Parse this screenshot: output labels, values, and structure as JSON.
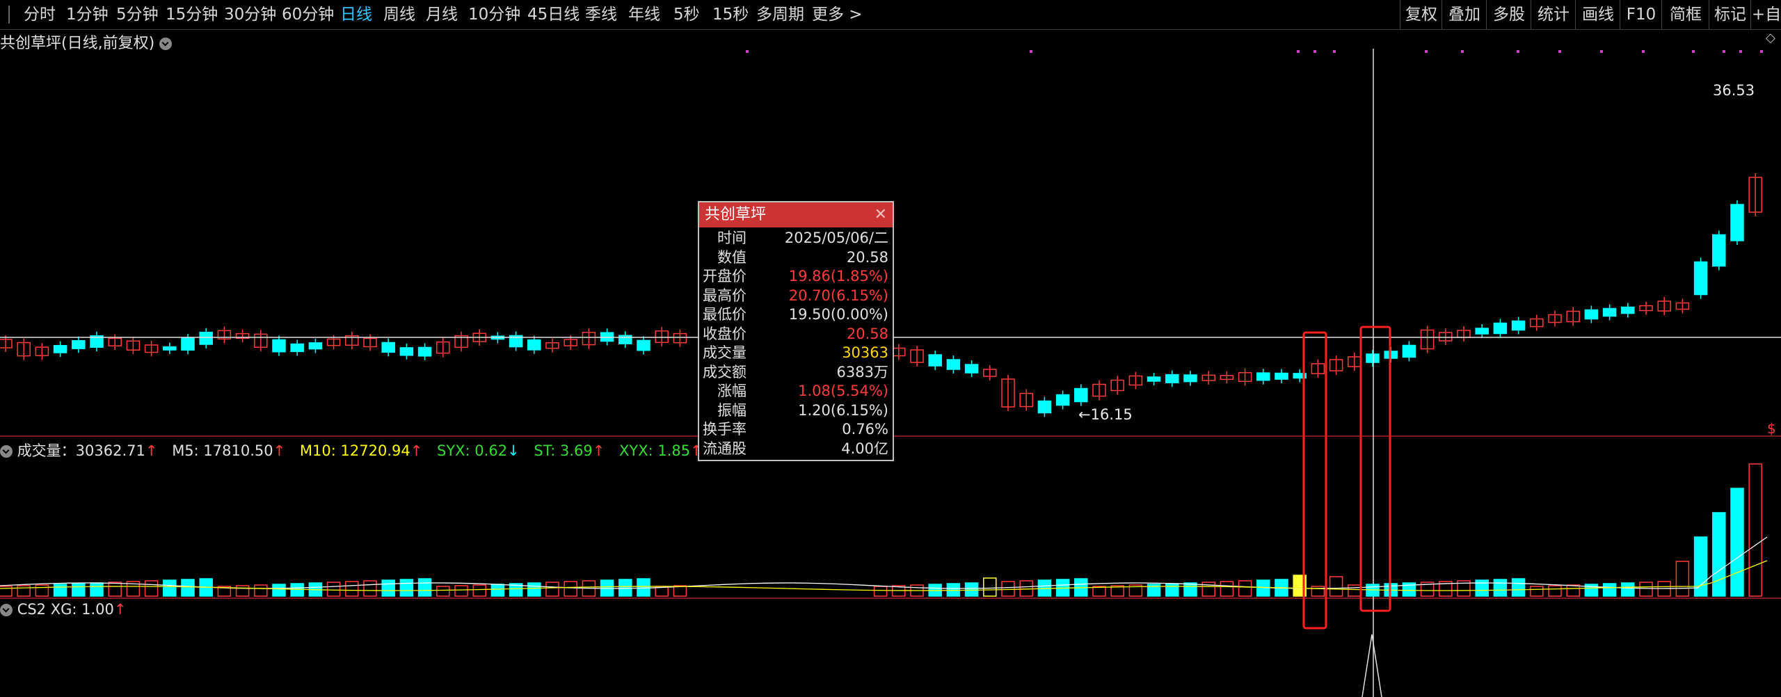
{
  "toolbar": {
    "periods": [
      {
        "label": "分时",
        "active": false
      },
      {
        "label": "1分钟",
        "active": false
      },
      {
        "label": "5分钟",
        "active": false
      },
      {
        "label": "15分钟",
        "active": false
      },
      {
        "label": "30分钟",
        "active": false
      },
      {
        "label": "60分钟",
        "active": false
      },
      {
        "label": "日线",
        "active": true
      },
      {
        "label": "周线",
        "active": false
      },
      {
        "label": "月线",
        "active": false
      },
      {
        "label": "10分钟",
        "active": false
      },
      {
        "label": "45日线",
        "active": false
      },
      {
        "label": "季线",
        "active": false
      },
      {
        "label": "年线",
        "active": false
      },
      {
        "label": "5秒",
        "active": false
      },
      {
        "label": "15秒",
        "active": false
      },
      {
        "label": "多周期",
        "active": false
      },
      {
        "label": "更多 >",
        "active": false
      }
    ],
    "right_buttons": [
      "复权",
      "叠加",
      "多股",
      "统计",
      "画线",
      "F10",
      "简框",
      "标记",
      "+自"
    ]
  },
  "chart_header": {
    "title": "共创草坪(日线,前复权)"
  },
  "price_labels": {
    "high": "36.53",
    "low": "16.15"
  },
  "volume_header": {
    "vol": "成交量：30362.71",
    "m5": "M5: 17810.50",
    "m10": "M10: 12720.94",
    "syx": "SYX: 0.62",
    "st": "ST: 3.69",
    "xyx": "XYX: 1.85"
  },
  "cs2_header": {
    "text": "CS2 XG: 1.00"
  },
  "tooltip": {
    "title": "共创草坪",
    "rows": [
      {
        "key": "时间",
        "value": "2025/05/06/二",
        "color": "#e0e0e0"
      },
      {
        "key": "数值",
        "value": "20.58",
        "color": "#e0e0e0"
      },
      {
        "key": "开盘价",
        "value": "19.86(1.85%)",
        "color": "#ff3b3b"
      },
      {
        "key": "最高价",
        "value": "20.70(6.15%)",
        "color": "#ff3b3b"
      },
      {
        "key": "最低价",
        "value": "19.50(0.00%)",
        "color": "#e0e0e0"
      },
      {
        "key": "收盘价",
        "value": "20.58",
        "color": "#ff3b3b"
      },
      {
        "key": "成交量",
        "value": "30363",
        "color": "#ffd700"
      },
      {
        "key": "成交额",
        "value": "6383万",
        "color": "#e0e0e0"
      },
      {
        "key": "涨幅",
        "value": "1.08(5.54%)",
        "color": "#ff3b3b"
      },
      {
        "key": "振幅",
        "value": "1.20(6.15%)",
        "color": "#e0e0e0"
      },
      {
        "key": "换手率",
        "value": "0.76%",
        "color": "#e0e0e0"
      },
      {
        "key": "流通股",
        "value": "4.00亿",
        "color": "#e0e0e0"
      }
    ]
  },
  "colors": {
    "up": "#ff3b3b",
    "down": "#00ffff",
    "crosshair": "#e0e0e0",
    "m5": "#ffffff",
    "m10": "#ffff00",
    "marker": "#d040d0",
    "highlight_box": "#ff2020"
  }
}
